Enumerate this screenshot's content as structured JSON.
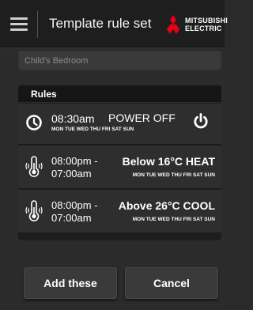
{
  "header": {
    "title": "Template rule set",
    "brand_line1": "MITSUBISHI",
    "brand_line2": "ELECTRIC",
    "menu_icon": "hamburger-icon"
  },
  "name_field": {
    "placeholder": "Child's Bedroom",
    "value": ""
  },
  "rules": {
    "heading": "Rules",
    "items": [
      {
        "icon": "clock-icon",
        "time": "08:30am",
        "action": "POWER OFF",
        "days": "MON TUE WED THU FRI SAT SUN",
        "action_icon": "power-icon"
      },
      {
        "icon": "thermometer-icon",
        "time_start": "08:00pm -",
        "time_end": "07:00am",
        "condition": "Below 16°C HEAT",
        "days": "MON TUE WED THU FRI SAT SUN"
      },
      {
        "icon": "thermometer-icon",
        "time_start": "08:00pm -",
        "time_end": "07:00am",
        "condition": "Above 26°C COOL",
        "days": "MON TUE WED THU FRI SAT SUN"
      }
    ]
  },
  "buttons": {
    "add": "Add these",
    "cancel": "Cancel"
  },
  "colors": {
    "brand_red": "#e60012",
    "background": "#2b2b2b",
    "header": "#1e1e1e"
  }
}
